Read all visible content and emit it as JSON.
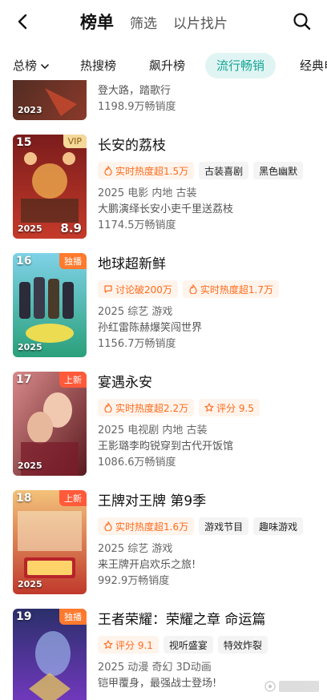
{
  "header": {
    "tabs": [
      "榜单",
      "筛选",
      "以片找片"
    ]
  },
  "categories": [
    "总榜",
    "热搜榜",
    "飙升榜",
    "流行畅销",
    "经典电"
  ],
  "items": [
    {
      "desc": "登大路，踏歌行",
      "sales": "1198.9万畅销度",
      "poster_year": "2023"
    },
    {
      "rank": "15",
      "tag": "VIP",
      "title": "长安的荔枝",
      "chips": [
        {
          "text": "实时热度超1.5万",
          "hot": true,
          "icon": "fire-icon"
        },
        {
          "text": "古装喜剧",
          "hot": false
        },
        {
          "text": "黑色幽默",
          "hot": false
        }
      ],
      "meta": "2025 电影 内地 古装",
      "desc": "大鹏演绎长安小吏千里送荔枝",
      "sales": "1174.5万畅销度",
      "poster_year": "2025",
      "poster_score": "8.9"
    },
    {
      "rank": "16",
      "tag": "独播",
      "title": "地球超新鲜",
      "chips": [
        {
          "text": "讨论破200万",
          "hot": true,
          "icon": "chat-icon"
        },
        {
          "text": "实时热度超1.7万",
          "hot": true,
          "icon": "fire-icon"
        }
      ],
      "meta": "2025 综艺 游戏",
      "desc": "孙红雷陈赫爆笑闯世界",
      "sales": "1156.7万畅销度",
      "poster_year": "2025"
    },
    {
      "rank": "17",
      "tag": "上新",
      "title": "宴遇永安",
      "chips": [
        {
          "text": "实时热度超2.2万",
          "hot": true,
          "icon": "fire-icon"
        },
        {
          "text": "评分 9.5",
          "hot": true,
          "icon": "star-icon"
        }
      ],
      "meta": "2025 电视剧 内地 古装",
      "desc": "王影璐李昀锐穿到古代开饭馆",
      "sales": "1086.6万畅销度",
      "poster_year": "2025"
    },
    {
      "rank": "18",
      "tag": "上新",
      "title": "王牌对王牌 第9季",
      "chips": [
        {
          "text": "实时热度超1.6万",
          "hot": true,
          "icon": "fire-icon"
        },
        {
          "text": "游戏节目",
          "hot": false
        },
        {
          "text": "趣味游戏",
          "hot": false
        }
      ],
      "meta": "2025 综艺 游戏",
      "desc": "来王牌开启欢乐之旅!",
      "sales": "992.9万畅销度",
      "poster_year": "2025"
    },
    {
      "rank": "19",
      "tag": "独播",
      "title": "王者荣耀：荣耀之章 命运篇",
      "chips": [
        {
          "text": "评分 9.1",
          "hot": true,
          "icon": "star-icon"
        },
        {
          "text": "视听盛宴",
          "hot": false
        },
        {
          "text": "特效炸裂",
          "hot": false
        }
      ],
      "meta": "2025 动漫 奇幻 3D动画",
      "desc": "铠甲覆身，最强战士登场!",
      "sales": "",
      "poster_year": ""
    }
  ],
  "colors": {
    "accent": "#17a596",
    "accent_bg": "#e0f5f3",
    "hot": "#ff6a1a",
    "hot_bg": "#fff4ec",
    "vip": "#f5d99a",
    "exclusive": "#ff7a2e",
    "new": "#ff5a3a"
  }
}
